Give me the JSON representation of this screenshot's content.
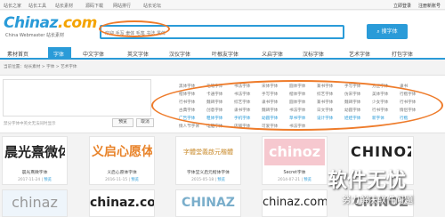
{
  "topbar": {
    "nav": [
      "站长之家",
      "站长工具",
      "站长素材",
      "源码下载",
      "网站排行",
      "站长论坛"
    ],
    "right": [
      "立即登录",
      "注册新账号"
    ]
  },
  "header": {
    "logo_main": "Chinaz",
    "logo_dot": ".com",
    "logo_sub": "China Webmaster 站长素材",
    "search_placeholder": "欢迎 手写 隶体 毛笔 书法 黑体",
    "search_button": "搜字体"
  },
  "nav": [
    "素材首页",
    "字体",
    "中文字体",
    "英文字体",
    "汉仪字体",
    "叶根友字体",
    "义启字体",
    "汉标字体",
    "艺术字体",
    "打包字体"
  ],
  "breadcrumb": "当前位置：站长素材 > 字体 > 艺术字体",
  "preview": {
    "note": "禁分字体中英文无法同时显示",
    "buttons": [
      "预览",
      "取消"
    ]
  },
  "font_grid": [
    [
      "黑体字体",
      "毛笔字体",
      "书法字体",
      "宋体字体",
      "圆体字体",
      "篆书字体",
      "手写字体",
      "方正字体",
      "隶书"
    ],
    [
      "楷体字体",
      "卡通字体",
      "书法字体",
      "手写字体",
      "楷体字体",
      "综艺字体",
      "仿宋字体",
      "美体字体",
      "行楷字体"
    ],
    [
      "行书字体",
      "魏碑字体",
      "综艺字体",
      "隶书字体",
      "圆体字体",
      "篆书字体",
      "魏碑字体",
      "少女字体",
      "行书字体"
    ],
    [
      "古典字体",
      "创意字体",
      "隶书字体",
      "魏碑字体",
      "书法字体",
      "日文字体",
      "幼圆字体",
      "行书字体",
      "情侣字体"
    ],
    [
      "广告字体",
      "粗体字体",
      "手机字体",
      "幼圆字体",
      "草书字体",
      "设计字体",
      "娃娃字体",
      "新字体",
      "行楷"
    ],
    [
      "情人节字体",
      "电脑字体",
      "店铺字体",
      "可爱字体",
      "书法字体",
      "",
      "",
      "",
      ""
    ]
  ],
  "cards": [
    {
      "thumb": "晨光熹微体",
      "title": "晨光熹微字体",
      "date": "2017-11-24",
      "link": "预览"
    },
    {
      "thumb": "义启心愿体",
      "title": "义启心愿体字体",
      "date": "2016-11-15",
      "link": "预览"
    },
    {
      "thumb": "字體堂義啟元楷體",
      "title": "字体堂义启元楷体字体",
      "date": "2015-05-18",
      "link": "预览"
    },
    {
      "thumb": "chinoz",
      "title": "Secret字体",
      "date": "2014-07-21",
      "link": "预览"
    },
    {
      "thumb": "CHINOZ",
      "title": "",
      "date": "",
      "link": ""
    }
  ],
  "row2": [
    "chinaz",
    "chinaz.com",
    "CHINAZ",
    "chinaz.com",
    "CHINOZ"
  ],
  "watermark": {
    "main": "软件无忧",
    "sub": "努力解决软件问题"
  },
  "colors": {
    "accent": "#2a9bd8",
    "highlight": "#ee7b2a"
  }
}
